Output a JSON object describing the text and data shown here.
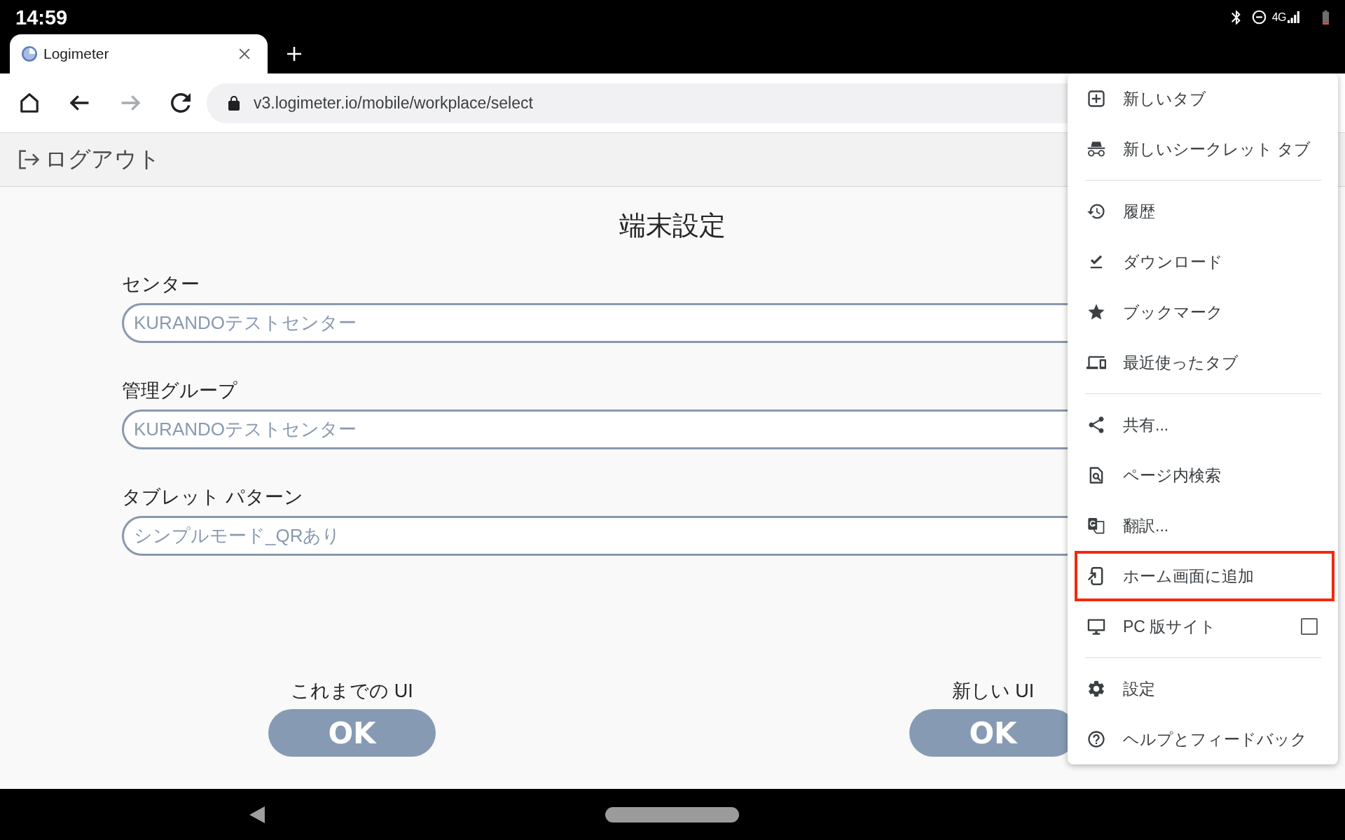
{
  "status_bar": {
    "time": "14:59",
    "network": "4G"
  },
  "browser": {
    "tabs": [
      {
        "title": "Logimeter",
        "selected": true
      }
    ],
    "toolbar": [
      {
        "kind": "home",
        "disabled": false
      },
      {
        "kind": "back",
        "disabled": false
      },
      {
        "kind": "forward",
        "disabled": true
      },
      {
        "kind": "reload",
        "disabled": false
      }
    ],
    "address_bar": {
      "url": "v3.logimeter.io/mobile/workplace/select"
    }
  },
  "page": {
    "header": {
      "logout": "ログアウト"
    },
    "title": "端末設定",
    "fields": [
      {
        "label": "センター",
        "value": "KURANDOテストセンター"
      },
      {
        "label": "管理グループ",
        "value": "KURANDOテストセンター"
      },
      {
        "label": "タブレット パターン",
        "value": "シンプルモード_QRあり"
      }
    ],
    "options": [
      {
        "caption": "これまでの UI",
        "button": "OK"
      },
      {
        "caption": "新しい UI",
        "button": "OK"
      }
    ]
  },
  "menu": {
    "sections": [
      {
        "items": [
          {
            "kind": "action",
            "label": "新しいタブ",
            "highlighted": false
          },
          {
            "kind": "action",
            "label": "新しいシークレット タブ",
            "highlighted": false
          }
        ]
      },
      {
        "items": [
          {
            "kind": "action",
            "label": "履歴",
            "highlighted": false
          },
          {
            "kind": "action",
            "label": "ダウンロード",
            "highlighted": false
          },
          {
            "kind": "action",
            "label": "ブックマーク",
            "highlighted": false
          },
          {
            "kind": "action",
            "label": "最近使ったタブ",
            "highlighted": false
          }
        ]
      },
      {
        "items": [
          {
            "kind": "action",
            "label": "共有...",
            "highlighted": false
          },
          {
            "kind": "action",
            "label": "ページ内検索",
            "highlighted": false
          },
          {
            "kind": "action",
            "label": "翻訳...",
            "highlighted": false
          },
          {
            "kind": "action",
            "label": "ホーム画面に追加",
            "highlighted": true
          },
          {
            "kind": "checkbox",
            "label": "PC 版サイト",
            "checked": false,
            "highlighted": false
          }
        ]
      },
      {
        "items": [
          {
            "kind": "action",
            "label": "設定",
            "highlighted": false
          },
          {
            "kind": "action",
            "label": "ヘルプとフィードバック",
            "highlighted": false
          }
        ]
      }
    ]
  }
}
